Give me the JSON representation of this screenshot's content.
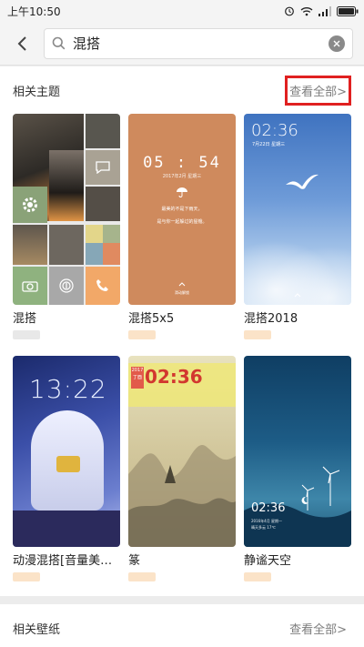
{
  "status": {
    "time": "上午10:50",
    "battery_icon": "battery-icon",
    "wifi_icon": "wifi-icon",
    "signal_icon": "signal-icon",
    "alarm_icon": "alarm-icon"
  },
  "search": {
    "value": "混搭",
    "icon": "search-icon",
    "clear_icon": "clear-icon",
    "back_icon": "back-arrow-icon"
  },
  "themes": {
    "title": "相关主题",
    "see_all": "查看全部>",
    "items": [
      {
        "name": "混搭"
      },
      {
        "name": "混搭5x5",
        "clock": "05 : 54",
        "date": "2017年2月 星期三",
        "verse_1": "最美的不是下雨天，",
        "verse_2": "是与你一起躲过的屋檐。",
        "unlock": "滑动解锁"
      },
      {
        "name": "混搭2018",
        "clock": "02:36",
        "date": "7月22日 星期三"
      },
      {
        "name": "动漫混搭[音量美…",
        "clock": "13:22"
      },
      {
        "name": "篆",
        "clock": "02:36",
        "stamp": "2017 丁酉"
      },
      {
        "name": "静谧天空",
        "clock": "02:36",
        "info_1": "2016年4月 星期一",
        "info_2": "晴天多云 17℃"
      }
    ]
  },
  "wallpapers": {
    "title": "相关壁纸",
    "see_all": "查看全部>"
  },
  "colors": {
    "highlight": "#e02020",
    "price_tag": "#fbe3c8"
  }
}
